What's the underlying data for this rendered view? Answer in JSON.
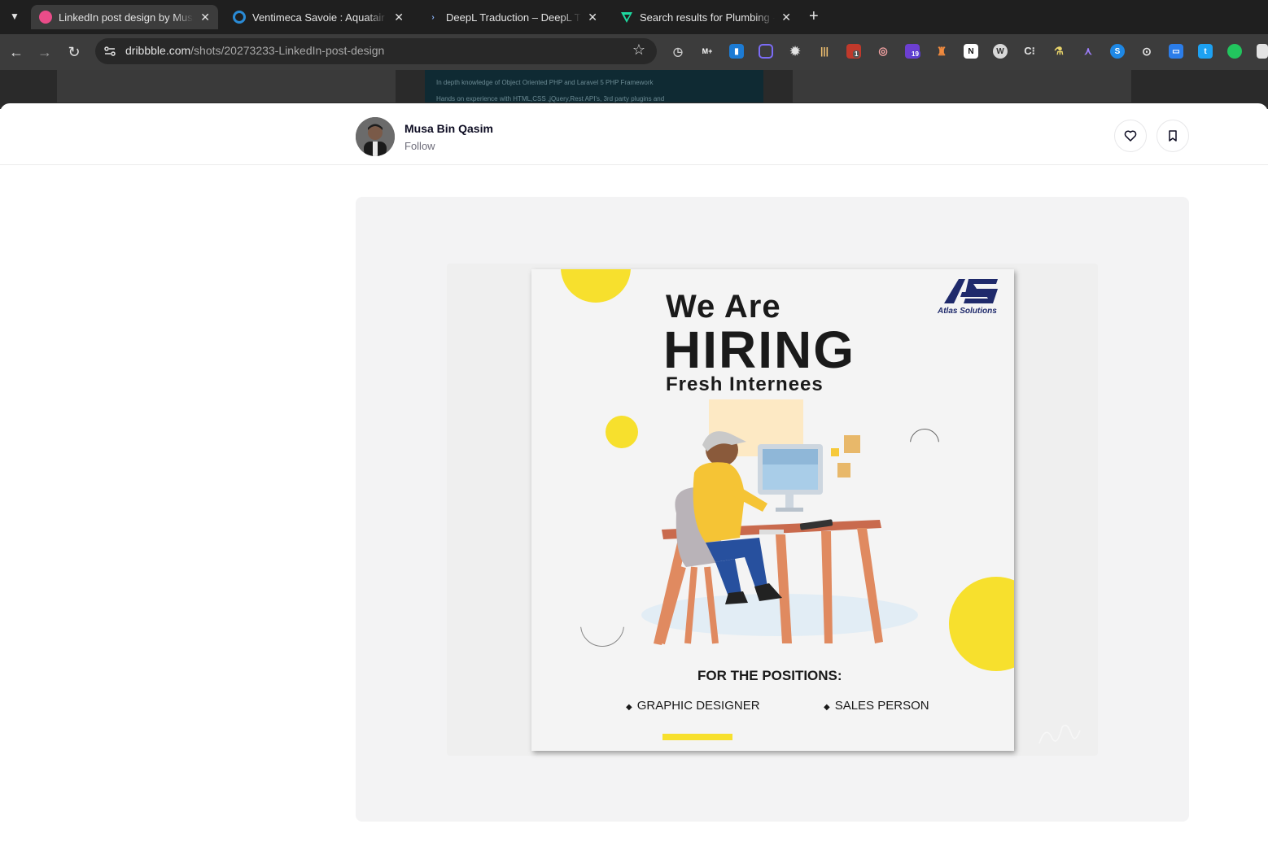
{
  "browser": {
    "tabs": [
      {
        "label": "LinkedIn post design by Musa Bin Qasim",
        "active": true,
        "favicon": "dribbble-icon",
        "color": "#ea4c89"
      },
      {
        "label": "Ventimeca Savoie : Aquatair Savoie",
        "active": false,
        "favicon": "ring-icon",
        "color": "#2a8bd6"
      },
      {
        "label": "DeepL Traduction – DeepL Translate",
        "active": false,
        "favicon": "deepl-icon",
        "color": "#8ab4f8"
      },
      {
        "label": "Search results for Plumbing - Flaticon",
        "active": false,
        "favicon": "flaticon-icon",
        "color": "#1ed9a0"
      }
    ],
    "url_domain": "dribbble.com",
    "url_path": "/shots/20273233-LinkedIn-post-design",
    "extensions": [
      "M+",
      "19",
      "1"
    ]
  },
  "shot": {
    "author": "Musa Bin Qasim",
    "follow_label": "Follow"
  },
  "poster": {
    "headline_1": "We Are",
    "headline_2": "HIRING",
    "headline_3": "Fresh Internees",
    "brand_logo": "AS",
    "brand_name": "Atlas Solutions",
    "positions_title": "FOR THE POSITIONS:",
    "position_1": "GRAPHIC DESIGNER",
    "position_2": "SALES PERSON"
  },
  "background_strip": {
    "line_1": "In depth knowledge of Object Oriented PHP and Laravel 5 PHP Framework",
    "line_2": "Hands on experience with HTML,CSS ,jQuery,Rest API's, 3rd party plugins and"
  },
  "colors": {
    "accent_yellow": "#f7e02d",
    "brand_navy": "#1f2a6b",
    "chrome_dark": "#1f1f1f",
    "chrome_toolbar": "#3c3c3c"
  }
}
